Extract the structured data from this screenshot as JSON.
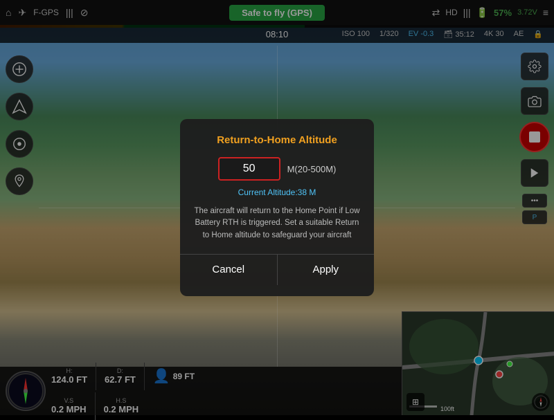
{
  "topbar": {
    "home_icon": "⌂",
    "drone_icon": "✈",
    "gps_label": "F-GPS",
    "signal_icon": "📶",
    "status_label": "Safe to fly (GPS)",
    "link_icon": "📡",
    "hd_label": "HD",
    "battery_icon": "🔋",
    "battery_percent": "57%",
    "battery_voltage": "3.72V",
    "menu_icon": "≡",
    "time_display": "08:10"
  },
  "camera_info": {
    "iso_label": "ISO",
    "iso_value": "100",
    "shutter": "1/320",
    "ev_label": "EV",
    "ev_value": "-0.3",
    "storage": "35:12",
    "resolution": "4K 30",
    "ae_label": "AE",
    "lock_icon": "🔒"
  },
  "modal": {
    "title": "Return-to-Home Altitude",
    "input_value": "50",
    "range_label": "M(20-500M)",
    "current_altitude": "Current Altitude:38 M",
    "description": "The aircraft will return to the Home Point if Low Battery RTH is triggered. Set a suitable Return to Home altitude to safeguard your aircraft",
    "cancel_label": "Cancel",
    "apply_label": "Apply"
  },
  "hud": {
    "h_label": "H:",
    "h_value": "124.0 FT",
    "d_label": "D:",
    "d_value": "62.7 FT",
    "vs_label": "V.S",
    "vs_value": "0.2 MPH",
    "hs_label": "H.S",
    "hs_value": "0.2 MPH",
    "alt_label": "89 FT",
    "person_icon": "👤"
  },
  "right_sidebar": {
    "camera_settings_icon": "⚙",
    "camera_icon": "📷",
    "video_icon": "🎬",
    "record_icon": "⏺",
    "play_icon": "▶",
    "settings2_icon": "⚙",
    "parking_icon": "P"
  },
  "left_sidebar": {
    "takeoff_icon": "⬆",
    "nav_icon": "◎",
    "orbit_icon": "↺",
    "map_icon": "📍"
  }
}
